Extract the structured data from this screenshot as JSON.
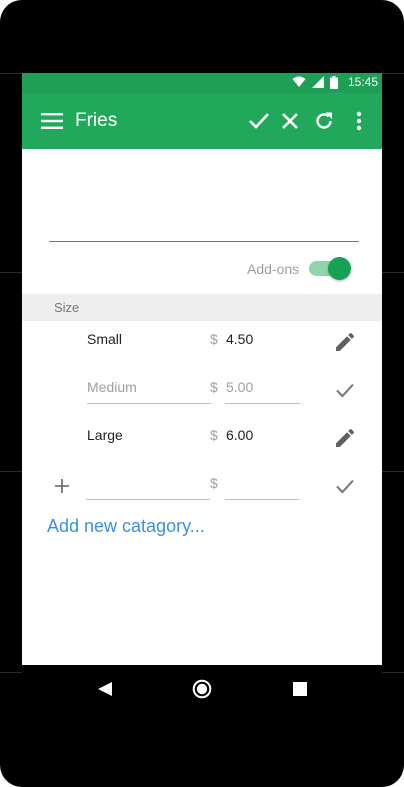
{
  "status_bar": {
    "time": "15:45"
  },
  "toolbar": {
    "title": "Fries"
  },
  "item": {
    "name_value": ""
  },
  "addons": {
    "label": "Add-ons",
    "enabled": true
  },
  "section": {
    "title": "Size"
  },
  "sizes": [
    {
      "name": "Small",
      "currency": "$",
      "price": "4.50",
      "mode": "view"
    },
    {
      "name": "Medium",
      "currency": "$",
      "price": "5.00",
      "mode": "edit"
    },
    {
      "name": "Large",
      "currency": "$",
      "price": "6.00",
      "mode": "view"
    }
  ],
  "new_size": {
    "name": "",
    "currency": "$",
    "price": ""
  },
  "add_category": {
    "label": "Add new catagory..."
  },
  "colors": {
    "toolbar": "#22a85a",
    "statusbar": "#1e9f55",
    "accent_link": "#3d8fe0",
    "toggle": "#16a155"
  }
}
